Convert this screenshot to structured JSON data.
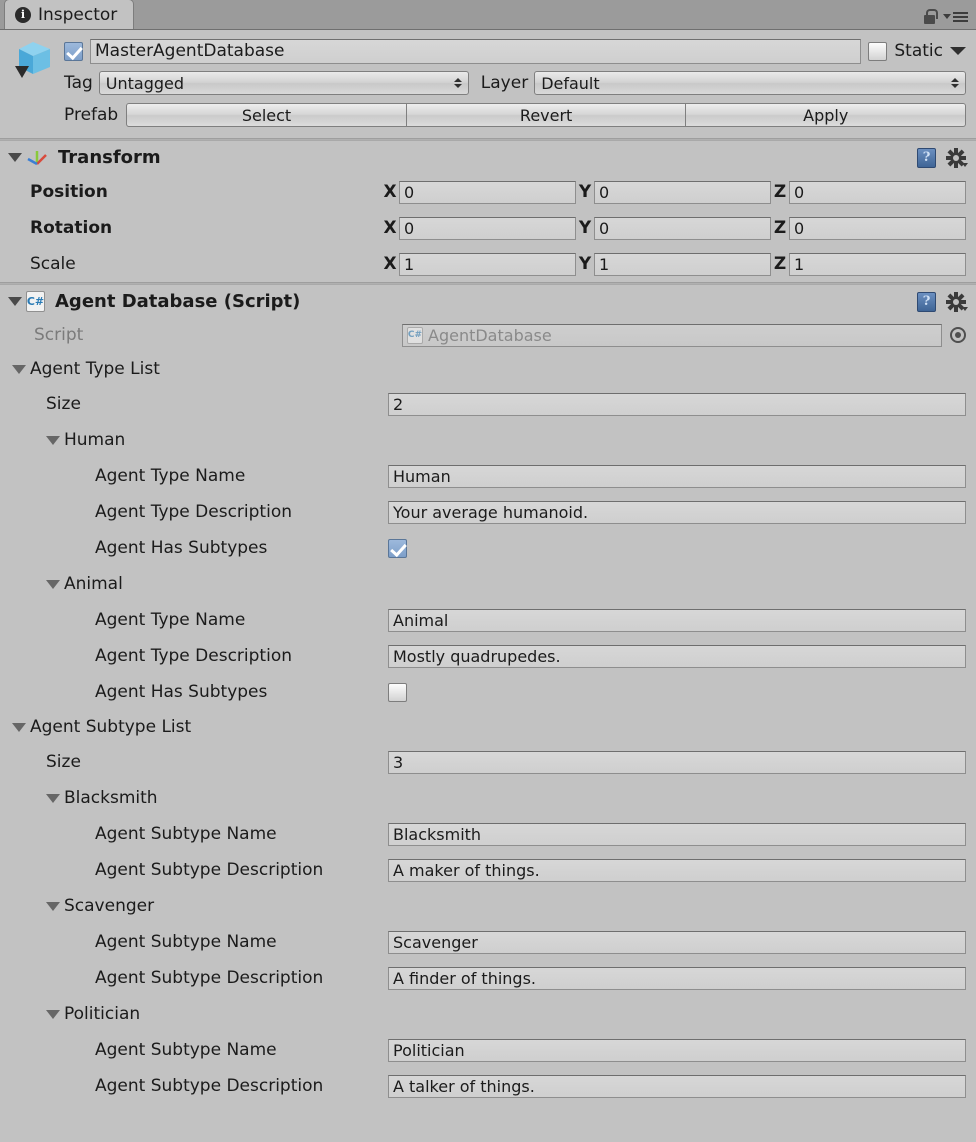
{
  "window": {
    "tab_label": "Inspector",
    "tab_icon": "info-icon",
    "lock_icon": "lock-icon",
    "menu_icon": "hamburger-menu-icon"
  },
  "object_header": {
    "enabled": true,
    "name_value": "MasterAgentDatabase",
    "static_label": "Static",
    "static_checked": false,
    "tag_label": "Tag",
    "tag_value": "Untagged",
    "layer_label": "Layer",
    "layer_value": "Default",
    "prefab_label": "Prefab",
    "prefab_buttons": [
      "Select",
      "Revert",
      "Apply"
    ]
  },
  "transform": {
    "title": "Transform",
    "help_glyph": "?",
    "rows": [
      {
        "label": "Position",
        "bold": true,
        "x": "0",
        "y": "0",
        "z": "0"
      },
      {
        "label": "Rotation",
        "bold": true,
        "x": "0",
        "y": "0",
        "z": "0"
      },
      {
        "label": "Scale",
        "bold": false,
        "x": "1",
        "y": "1",
        "z": "1"
      }
    ],
    "axis_labels": [
      "X",
      "Y",
      "Z"
    ]
  },
  "script_component": {
    "title": "Agent Database (Script)",
    "help_glyph": "?",
    "script_label": "Script",
    "script_value": "AgentDatabase",
    "cs_glyph": "C#"
  },
  "agent_type_list": {
    "title": "Agent Type List",
    "size_label": "Size",
    "size_value": "2",
    "elements": [
      {
        "foldout_label": "Human",
        "name_label": "Agent Type Name",
        "name_value": "Human",
        "desc_label": "Agent Type Description",
        "desc_value": "Your average humanoid.",
        "subtypes_label": "Agent Has Subtypes",
        "subtypes_checked": true
      },
      {
        "foldout_label": "Animal",
        "name_label": "Agent Type Name",
        "name_value": "Animal",
        "desc_label": "Agent Type Description",
        "desc_value": "Mostly quadrupedes.",
        "subtypes_label": "Agent Has Subtypes",
        "subtypes_checked": false
      }
    ]
  },
  "agent_subtype_list": {
    "title": "Agent Subtype List",
    "size_label": "Size",
    "size_value": "3",
    "elements": [
      {
        "foldout_label": "Blacksmith",
        "name_label": "Agent Subtype Name",
        "name_value": "Blacksmith",
        "desc_label": "Agent Subtype Description",
        "desc_value": "A maker of things."
      },
      {
        "foldout_label": "Scavenger",
        "name_label": "Agent Subtype Name",
        "name_value": "Scavenger",
        "desc_label": "Agent Subtype Description",
        "desc_value": "A finder of things."
      },
      {
        "foldout_label": "Politician",
        "name_label": "Agent Subtype Name",
        "name_value": "Politician",
        "desc_label": "Agent Subtype Description",
        "desc_value": "A talker of things."
      }
    ]
  },
  "colors": {
    "background": "#c2c2c2",
    "tabbar": "#9b9b9b",
    "field": "#d4d4d4",
    "checkbox_on": "#7d9fc9",
    "text": "#1b1b1b",
    "text_dim": "#7b7b7b"
  }
}
